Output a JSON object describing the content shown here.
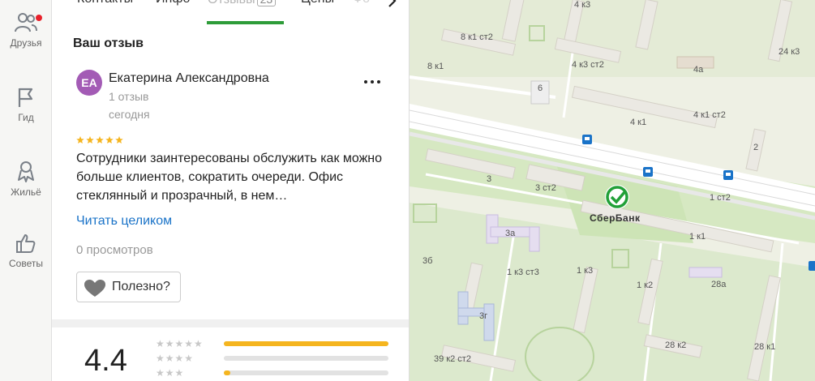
{
  "rail": {
    "friends": "Друзья",
    "guide": "Гид",
    "housing": "Жильё",
    "tips": "Советы"
  },
  "tabs": [
    {
      "label": "Контакты"
    },
    {
      "label": "Инфо"
    },
    {
      "label": "Отзывы",
      "badge": "23"
    },
    {
      "label": "Цены"
    },
    {
      "label": "Фо"
    }
  ],
  "review": {
    "section_title": "Ваш отзыв",
    "avatar_initials": "ЕА",
    "author": "Екатерина Александровна",
    "author_reviews": "1 отзыв",
    "date": "сегодня",
    "stars": 5,
    "text": "Сотрудники заинтересованы обслужить как можно больше клиентов, сократить очереди. Офис стеклянный и прозрачный, в нем…",
    "read_more": "Читать целиком",
    "views": "0 просмотров",
    "useful": "Полезно?"
  },
  "rating": {
    "value": "4.4",
    "distribution": [
      {
        "stars": 5,
        "fraction": 1.0
      },
      {
        "stars": 4,
        "fraction": 0.0
      },
      {
        "stars": 3,
        "fraction": 0.04
      }
    ]
  },
  "map": {
    "poi": "СберБанк",
    "labels": [
      "4 к3",
      "8 к1 ст2",
      "8 к1",
      "4 к3 ст2",
      "4а",
      "24 к3",
      "6",
      "4 к1",
      "4 к1 ст2",
      "2",
      "3",
      "3 ст2",
      "1 ст2",
      "3а",
      "1 к1",
      "3б",
      "1 к3 ст3",
      "1 к3",
      "1 к2",
      "28а",
      "3г",
      "39 к2 ст2",
      "28 к2",
      "28 к1"
    ]
  },
  "colors": {
    "accent_green": "#2e9c39",
    "link_blue": "#1a73c8",
    "star_yellow": "#f5b51f",
    "avatar": "#a35bb5"
  }
}
